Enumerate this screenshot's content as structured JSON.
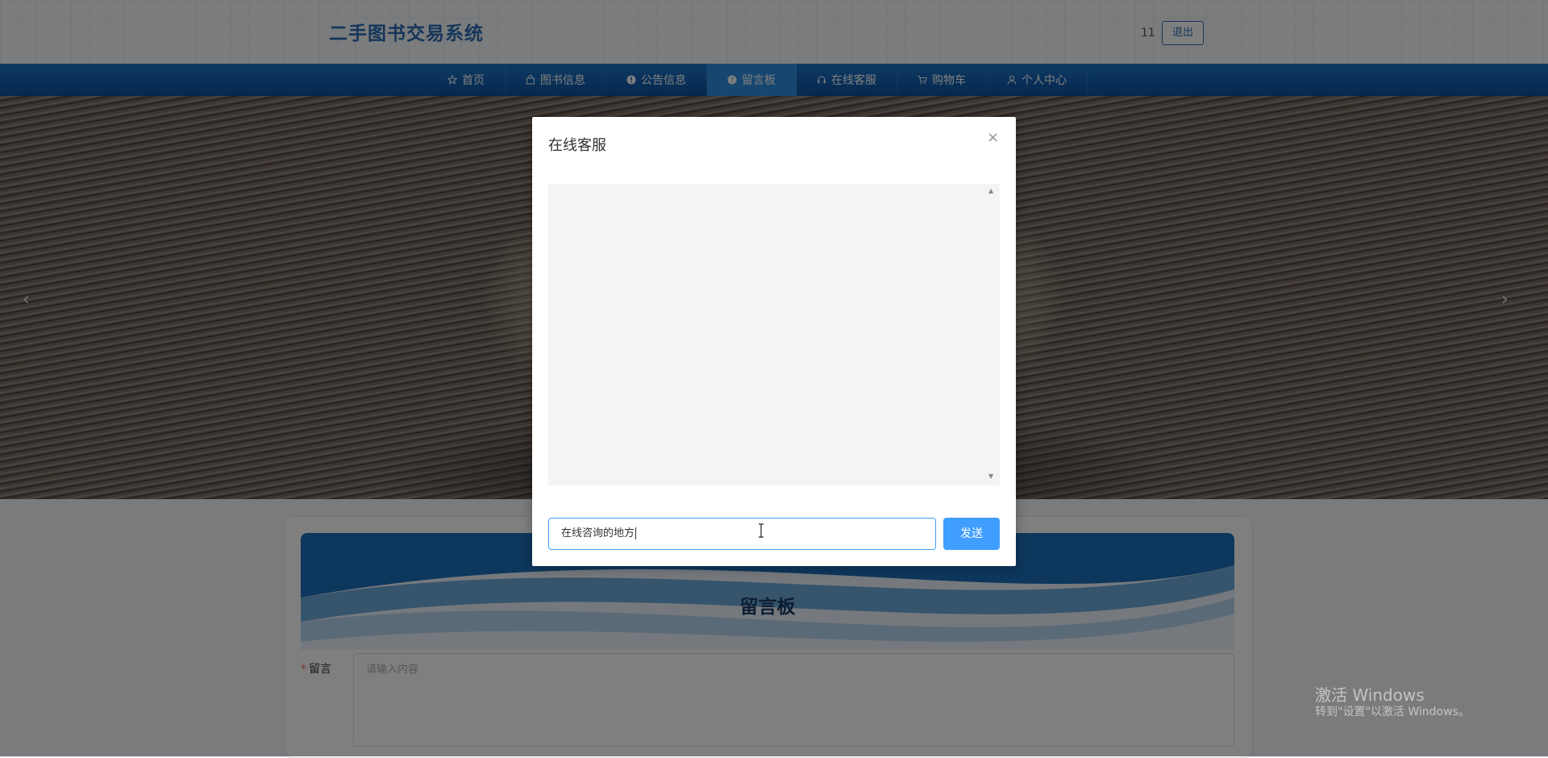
{
  "header": {
    "site_title": "二手图书交易系统",
    "user_name": "11",
    "logout_label": "退出"
  },
  "nav": {
    "items": [
      {
        "label": "首页",
        "icon": "star-icon"
      },
      {
        "label": "图书信息",
        "icon": "bag-icon"
      },
      {
        "label": "公告信息",
        "icon": "info-icon"
      },
      {
        "label": "留言板",
        "icon": "question-icon",
        "active": true
      },
      {
        "label": "在线客服",
        "icon": "headset-icon"
      },
      {
        "label": "购物车",
        "icon": "cart-icon"
      },
      {
        "label": "个人中心",
        "icon": "user-icon"
      }
    ]
  },
  "banner": {
    "prev_arrow": "‹",
    "next_arrow": "›"
  },
  "message_board": {
    "title": "留言板",
    "field_label": "留言",
    "required_mark": "*",
    "placeholder": "请输入内容"
  },
  "chat_modal": {
    "title": "在线客服",
    "close_icon": "×",
    "input_value": "在线咨询的地方",
    "send_label": "发送"
  },
  "watermark": {
    "line1": "激活 Windows",
    "line2": "转到\"设置\"以激活 Windows。"
  },
  "colors": {
    "brand_blue": "#2a6db5",
    "nav_blue": "#0b4f9c",
    "primary": "#409eff"
  }
}
